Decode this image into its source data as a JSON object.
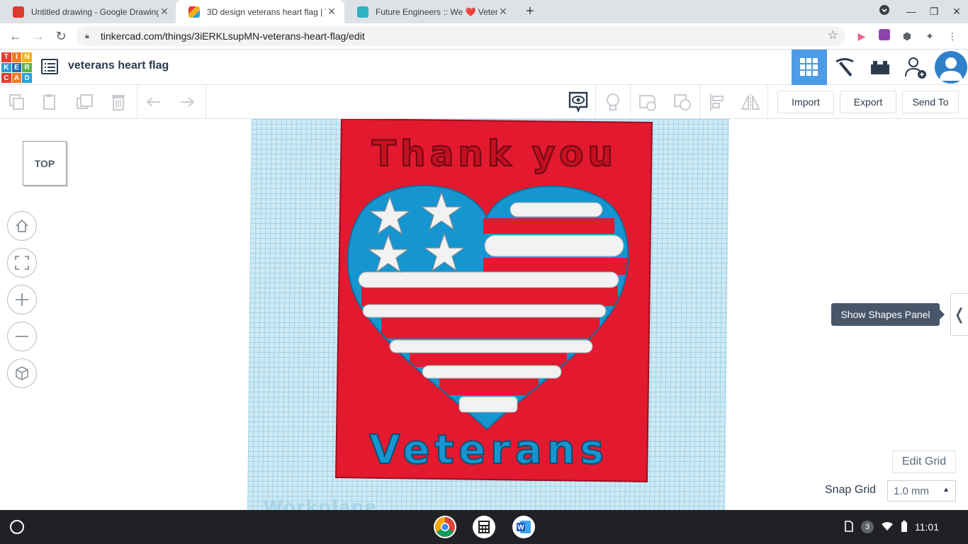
{
  "browser": {
    "tabs": [
      {
        "title": "Untitled drawing - Google Drawings",
        "favicon_color": "#db3b2f"
      },
      {
        "title": "3D design veterans heart flag | Tinkercad",
        "favicon_color": "#3a86ff"
      },
      {
        "title": "Future Engineers :: We ❤️ Veterans",
        "favicon_color": "#2bb3c0"
      }
    ],
    "url": "tinkercad.com/things/3iERKLsupMN-veterans-heart-flag/edit"
  },
  "app": {
    "logo_letters": [
      "T",
      "I",
      "N",
      "K",
      "E",
      "R",
      "C",
      "A",
      "D"
    ],
    "logo_colors": [
      "#e63c2f",
      "#f47a20",
      "#f6b11b",
      "#2a9fd8",
      "#1f6fb8",
      "#59b548",
      "#e63c2f",
      "#f47a20",
      "#2a9fd8"
    ],
    "design_title": "veterans heart flag"
  },
  "toolbar": {
    "import_label": "Import",
    "export_label": "Export",
    "send_to_label": "Send To"
  },
  "workspace": {
    "view_cube_label": "TOP",
    "workplane_label": "Workplane",
    "tooltip": "Show Shapes Panel",
    "edit_grid_label": "Edit Grid",
    "snap_grid_label": "Snap Grid",
    "snap_grid_value": "1.0 mm"
  },
  "design": {
    "top_text": "Thank you",
    "bottom_text": "Veterans",
    "colors": {
      "red": "#e2192f",
      "blue": "#1596d0",
      "white": "#f2f2f2"
    }
  },
  "shelf": {
    "notification_count": "3",
    "time": "11:01"
  }
}
